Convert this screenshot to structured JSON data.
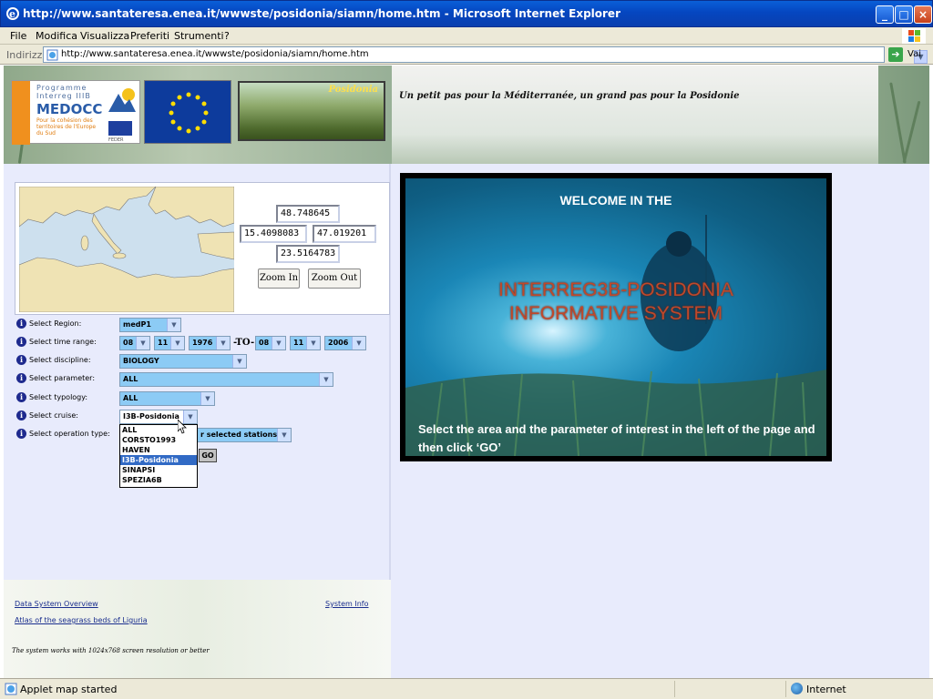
{
  "window": {
    "title": "http://www.santateresa.enea.it/wwwste/posidonia/siamn/home.htm - Microsoft Internet Explorer"
  },
  "menu": {
    "items": [
      "File",
      "Modifica",
      "Visualizza",
      "Preferiti",
      "Strumenti",
      "?"
    ]
  },
  "address": {
    "label": "Indirizzo",
    "url": "http://www.santateresa.enea.it/wwwste/posidonia/siamn/home.htm",
    "go_label": "Vai"
  },
  "header": {
    "medocc": {
      "programme": "Programme",
      "interreg": "Interreg IIIB",
      "name": "MEDOCC",
      "subtitle": "Pour la cohésion des territoires de l'Europe du Sud",
      "feder": "FEDER"
    },
    "posidonia_title": "Posidonia",
    "tagline": "Un petit pas pour la Méditerranée, un grand pas pour la Posidonie"
  },
  "map": {
    "north": "48.748645",
    "west": "15.4098083",
    "east": "47.019201",
    "south": "23.5164783",
    "zoom_in": "Zoom In",
    "zoom_out": "Zoom Out"
  },
  "form": {
    "region": {
      "label": "Select Region:",
      "value": "medP1"
    },
    "time": {
      "label": "Select time range:",
      "from_day": "08",
      "from_month": "11",
      "from_year": "1976",
      "to_label": "-TO-",
      "to_day": "08",
      "to_month": "11",
      "to_year": "2006"
    },
    "discipline": {
      "label": "Select discipline:",
      "value": "BIOLOGY"
    },
    "parameter": {
      "label": "Select parameter:",
      "value": "ALL"
    },
    "typology": {
      "label": "Select typology:",
      "value": "ALL"
    },
    "cruise": {
      "label": "Select cruise:",
      "value": "I3B-Posidonia",
      "options": [
        "ALL",
        "CORSTO1993",
        "HAVEN",
        "I3B-Posidonia",
        "SINAPSI",
        "SPEZIA6B"
      ],
      "highlighted_index": 3
    },
    "operation": {
      "label": "Select operation type:",
      "value": "r selected stations"
    },
    "go_label": "GO"
  },
  "footer": {
    "overview_link": "Data System Overview",
    "info_link": "System Info",
    "atlas_link": "Atlas of the seagrass beds of Liguria",
    "note": "The system works with 1024x768 screen resolution or better"
  },
  "welcome": {
    "title": "WELCOME  IN THE",
    "main_line1": "INTERREG3B-POSIDONIA",
    "main_line2": "INFORMATIVE SYSTEM",
    "instructions": "Select the area and the parameter of interest in the left of the page and then  click ‘GO’"
  },
  "status": {
    "text": "Applet map started",
    "zone": "Internet"
  },
  "colors": {
    "titlebar": "#0546c0",
    "page_bg": "#e8ebfc",
    "select_bg": "#8ccbf5",
    "welcome_red": "#c0482a"
  }
}
